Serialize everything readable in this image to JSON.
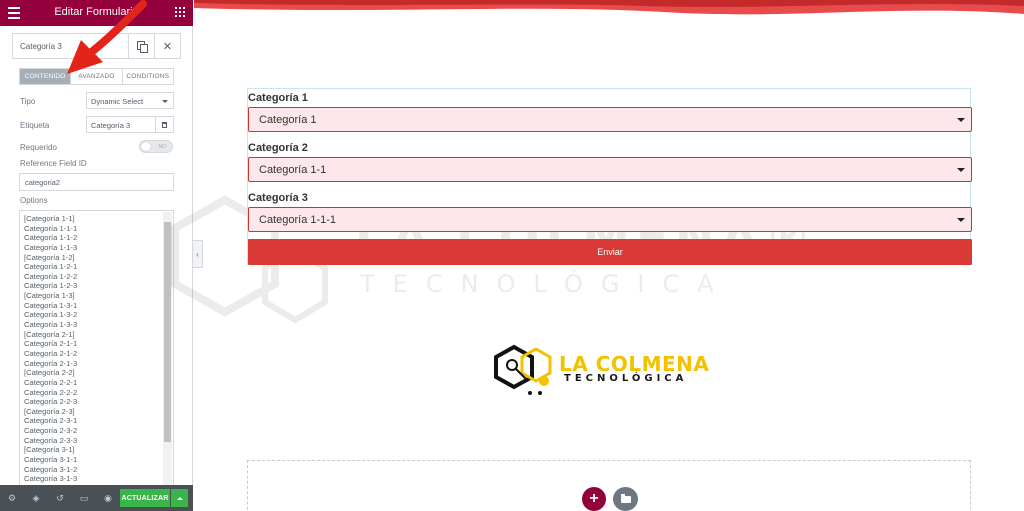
{
  "panel": {
    "header_title": "Editar Formulario",
    "widget_name": "Categoría 3",
    "tabs": [
      {
        "label": "CONTENIDO",
        "active": true
      },
      {
        "label": "AVANZADO",
        "active": false
      },
      {
        "label": "CONDITIONS",
        "active": false
      }
    ],
    "tipo_label": "Tipo",
    "tipo_value": "Dynamic Select",
    "etiqueta_label": "Etiqueta",
    "etiqueta_value": "Categoría 3",
    "requerido_label": "Requerido",
    "requerido_switch_text": "NO",
    "reference_label": "Reference Field ID",
    "reference_value": "categoria2",
    "options_label": "Options",
    "options": [
      "[Categoría 1-1]",
      "Categoría 1-1-1",
      "Categoría 1-1-2",
      "Categoría 1-1-3",
      "[Categoría 1-2]",
      "Categoría 1-2-1",
      "Categoría 1-2-2",
      "Categoría 1-2-3",
      "[Categoría 1-3]",
      "Categoría 1-3-1",
      "Categoría 1-3-2",
      "Categoría 1-3-3",
      "[Categoría 2-1]",
      "Categoría 2-1-1",
      "Categoría 2-1-2",
      "Categoría 2-1-3",
      "[Categoría 2-2]",
      "Categoría 2-2-1",
      "Categoría 2-2-2",
      "Categoría 2-2-3",
      "[Categoría 2-3]",
      "Categoría 2-3-1",
      "Categoría 2-3-2",
      "Categoría 2-3-3",
      "[Categoría 3-1]",
      "Categoría 3-1-1",
      "Categoría 3-1-2",
      "Categoría 3-1-3"
    ],
    "footer_update_label": "ACTUALIZAR"
  },
  "form": {
    "fields": [
      {
        "label": "Categoría 1",
        "selected": "Categoría 1"
      },
      {
        "label": "Categoría 2",
        "selected": "Categoría 1-1"
      },
      {
        "label": "Categoría 3",
        "selected": "Categoría 1-1-1"
      }
    ],
    "submit_label": "Enviar"
  },
  "logo": {
    "line1": "LA COLMENA",
    "line2": "TECNOLÓGICA"
  },
  "watermark": {
    "line1": "LA COLMENA®",
    "line2": "TECNOLÓGICA"
  },
  "colors": {
    "header_bg": "#93003c",
    "accent_red": "#d93a35",
    "select_bg": "#fde7ea",
    "update_green": "#39b54a",
    "footer_bg": "#495157",
    "logo_yellow": "#f2c200"
  },
  "icons": {
    "header_menu": "hamburger-icon",
    "header_apps": "grid-icon",
    "duplicate": "duplicate-icon",
    "close": "close-icon",
    "delete": "trash-icon",
    "footer": [
      "settings-icon",
      "layers-icon",
      "history-icon",
      "responsive-icon",
      "preview-icon"
    ],
    "add": "plus-icon",
    "templates": "folder-icon"
  }
}
